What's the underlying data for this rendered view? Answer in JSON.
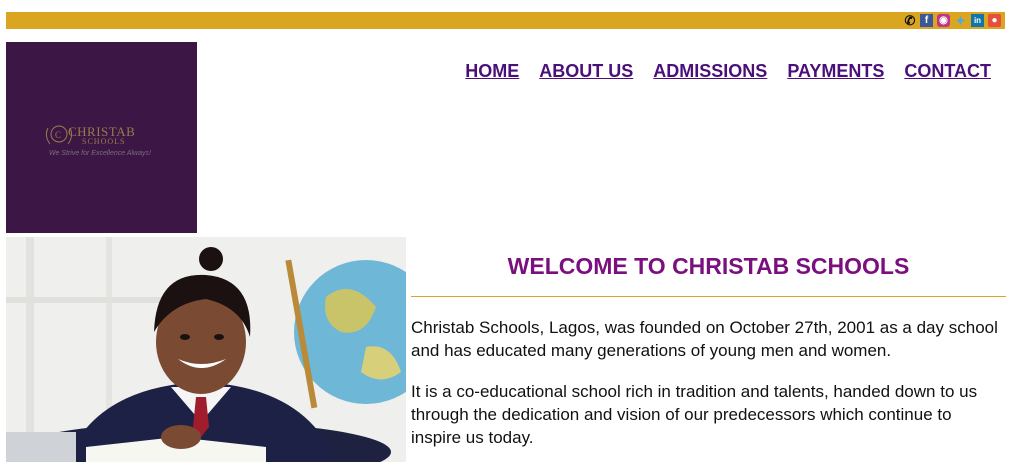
{
  "topbar": {
    "icons": [
      "phone-icon",
      "facebook-icon",
      "instagram-icon",
      "twitter-icon",
      "linkedin-icon",
      "map-pin-icon"
    ],
    "color": "#DAA520"
  },
  "logo": {
    "name": "CHRISTAB",
    "sub": "SCHOOLS",
    "tagline": "We Strive for Excellence Always!",
    "bg": "#3c1746"
  },
  "nav": {
    "items": [
      {
        "label": "HOME"
      },
      {
        "label": "ABOUT US"
      },
      {
        "label": "ADMISSIONS"
      },
      {
        "label": "PAYMENTS"
      },
      {
        "label": "CONTACT"
      }
    ]
  },
  "main": {
    "heading": "WELCOME TO CHRISTAB SCHOOLS",
    "paragraphs": [
      "Christab Schools, Lagos, was founded on October 27th, 2001 as a day school and has educated many generations of young men and women.",
      "It is a co-educational school rich in tradition and talents, handed down to us through the dedication and vision of our predecessors which continue to inspire us today."
    ]
  },
  "colors": {
    "accent": "#DAA520",
    "nav_text": "#4b0f7a",
    "heading": "#7a0f7e"
  }
}
